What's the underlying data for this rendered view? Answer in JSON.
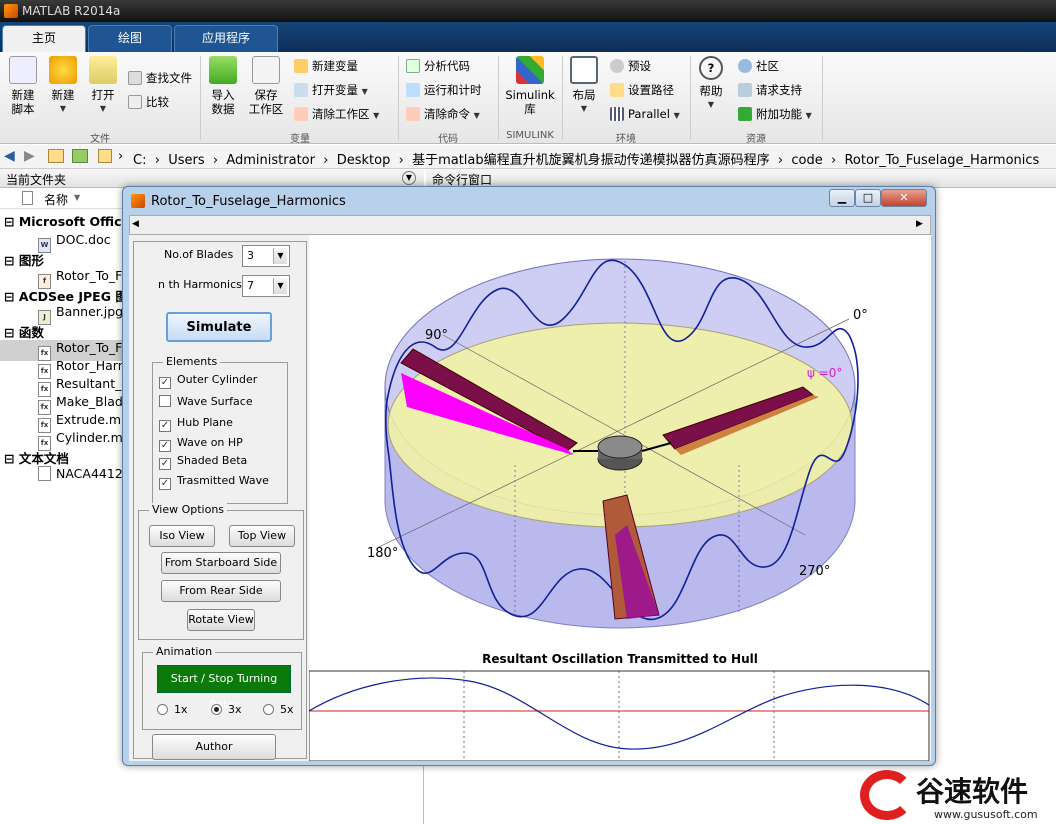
{
  "app": {
    "title": "MATLAB R2014a"
  },
  "tabs": [
    {
      "label": "主页",
      "active": true
    },
    {
      "label": "绘图",
      "active": false
    },
    {
      "label": "应用程序",
      "active": false
    }
  ],
  "ribbon": {
    "file": {
      "new_script": "新建\n脚本",
      "new": "新建",
      "open": "打开",
      "find_files": "查找文件",
      "compare": "比较",
      "group": "文件"
    },
    "variable": {
      "import": "导入\n数据",
      "save": "保存\n工作区",
      "new_var": "新建变量",
      "open_var": "打开变量",
      "clear_ws": "清除工作区",
      "group": "变量"
    },
    "code": {
      "analyze": "分析代码",
      "run_time": "运行和计时",
      "clear_cmd": "清除命令",
      "group": "代码"
    },
    "simulink": {
      "lib": "Simulink\n库",
      "group": "SIMULINK"
    },
    "env": {
      "layout": "布局",
      "prefs": "预设",
      "set_path": "设置路径",
      "parallel": "Parallel",
      "group": "环境"
    },
    "resources": {
      "help": "帮助",
      "community": "社区",
      "support": "请求支持",
      "addons": "附加功能",
      "group": "资源"
    }
  },
  "address": {
    "segments": [
      "C:",
      "Users",
      "Administrator",
      "Desktop",
      "基于matlab编程直升机旋翼机身振动传递模拟器仿真源码程序",
      "code",
      "Rotor_To_Fuselage_Harmonics"
    ]
  },
  "left_panel": {
    "title": "当前文件夹",
    "col_name": "名称",
    "groups": [
      {
        "label": "Microsoft Office",
        "items": [
          "DOC.doc"
        ]
      },
      {
        "label": "图形",
        "items": [
          "Rotor_To_F"
        ]
      },
      {
        "label": "ACDSee JPEG 图像",
        "items": [
          "Banner.jpg"
        ]
      },
      {
        "label": "函数",
        "items": [
          "Rotor_To_F",
          "Rotor_Harm",
          "Resultant_C",
          "Make_Blad",
          "Extrude.m",
          "Cylinder.m"
        ]
      },
      {
        "label": "文本文档",
        "items": [
          "NACA4412"
        ]
      }
    ]
  },
  "right_panel": {
    "title": "命令行窗口"
  },
  "figure": {
    "title": "Rotor_To_Fuselage_Harmonics",
    "controls": {
      "blades_label": "No.of Blades",
      "blades_value": "3",
      "harm_label": "n th Harmonics",
      "harm_value": "7",
      "simulate": "Simulate",
      "elements_title": "Elements",
      "elements": [
        {
          "label": "Outer Cylinder",
          "checked": true
        },
        {
          "label": "Wave Surface",
          "checked": false
        },
        {
          "label": "Hub Plane",
          "checked": true
        },
        {
          "label": "Wave on HP",
          "checked": true
        },
        {
          "label": "Shaded Beta",
          "checked": true
        },
        {
          "label": "Trasmitted Wave",
          "checked": true
        }
      ],
      "view_title": "View Options",
      "iso_view": "Iso View",
      "top_view": "Top View",
      "starboard": "From Starboard Side",
      "rear": "From Rear Side",
      "rotate": "Rotate View",
      "anim_title": "Animation",
      "start_stop": "Start / Stop Turning Rotor",
      "speeds": [
        {
          "label": "1x",
          "on": false
        },
        {
          "label": "3x",
          "on": true
        },
        {
          "label": "5x",
          "on": false
        }
      ],
      "author": "Author"
    },
    "plot": {
      "labels": {
        "a0": "0°",
        "a90": "90°",
        "a180": "180°",
        "a270": "270°",
        "psi": "ψ =0°"
      },
      "bottom_title": "Resultant Oscillation Transmitted to Hull"
    }
  },
  "watermark": {
    "brand": "谷速软件",
    "url": "www.gususoft.com"
  },
  "colors": {
    "tabbar": "#16457a",
    "go_button": "#0a7a0a",
    "cylinder": "#b9b9ee",
    "hub_plane": "#f4f4a0",
    "blade": "#7a0f4a"
  }
}
